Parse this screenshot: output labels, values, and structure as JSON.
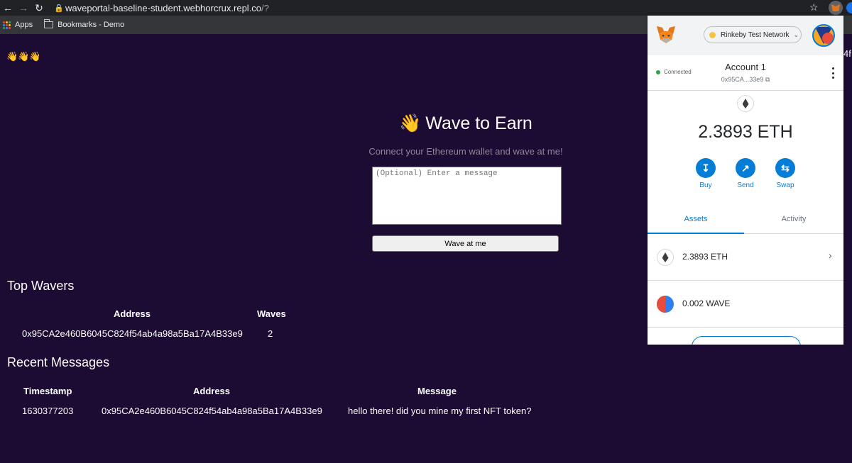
{
  "browser": {
    "url_host": "waveportal-baseline-student.webhorcrux.repl.co",
    "url_path": "/?",
    "bookmarks": [
      {
        "label": "Apps"
      },
      {
        "label": "Bookmarks - Demo"
      }
    ]
  },
  "page": {
    "top_emoji": "👋👋👋",
    "hero_emoji": "👋",
    "title": "Wave to Earn",
    "subtitle": "Connect your Ethereum wallet and wave at me!",
    "message_placeholder": "(Optional) Enter a message",
    "wave_button": "Wave at me",
    "edge_text": "4f",
    "top_wavers": {
      "heading": "Top Wavers",
      "columns": [
        "Address",
        "Waves"
      ],
      "rows": [
        {
          "address": "0x95CA2e460B6045C824f54ab4a98a5Ba17A4B33e9",
          "waves": "2"
        }
      ]
    },
    "recent_messages": {
      "heading": "Recent Messages",
      "columns": [
        "Timestamp",
        "Address",
        "Message"
      ],
      "rows": [
        {
          "timestamp": "1630377203",
          "address": "0x95CA2e460B6045C824f54ab4a98a5Ba17A4B33e9",
          "message": "hello there! did you mine my first NFT token?"
        }
      ]
    }
  },
  "metamask": {
    "network": "Rinkeby Test Network",
    "status": "Connected",
    "account_name": "Account 1",
    "account_address": "0x95CA...33e9",
    "balance": "2.3893 ETH",
    "actions": [
      {
        "label": "Buy",
        "icon": "download-icon"
      },
      {
        "label": "Send",
        "icon": "arrow-up-right-icon"
      },
      {
        "label": "Swap",
        "icon": "swap-icon"
      }
    ],
    "tabs": [
      "Assets",
      "Activity"
    ],
    "assets": [
      {
        "label": "2.3893 ETH"
      },
      {
        "label": "0.002 WAVE"
      }
    ],
    "colors": {
      "accent": "#037dd6",
      "network_dot": "#f6c343",
      "connected": "#28a745"
    }
  }
}
